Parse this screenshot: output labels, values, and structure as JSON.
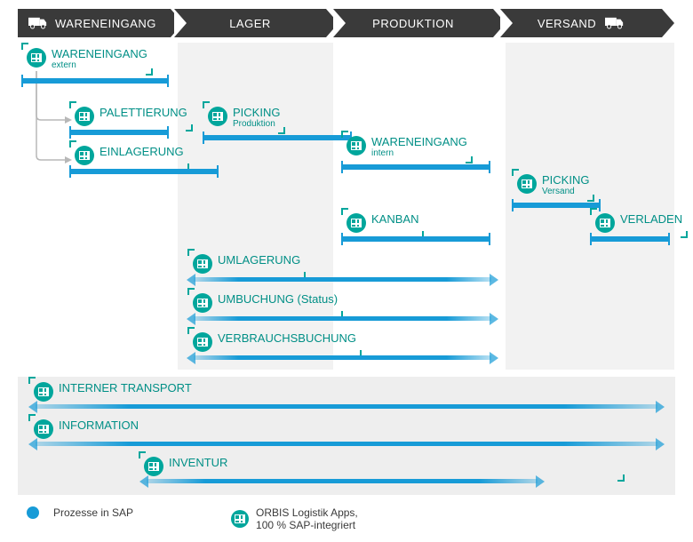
{
  "header": {
    "columns": [
      "WARENEINGANG",
      "LAGER",
      "PRODUKTION",
      "VERSAND"
    ]
  },
  "processes": {
    "wareneingang_extern": {
      "title": "WARENEINGANG",
      "sub": "extern"
    },
    "palettierung": {
      "title": "PALETTIERUNG"
    },
    "einlagerung": {
      "title": "EINLAGERUNG"
    },
    "picking_produktion": {
      "title": "PICKING",
      "sub": "Produktion"
    },
    "wareneingang_intern": {
      "title": "WARENEINGANG",
      "sub": "intern"
    },
    "kanban": {
      "title": "KANBAN"
    },
    "picking_versand": {
      "title": "PICKING",
      "sub": "Versand"
    },
    "verladen": {
      "title": "VERLADEN"
    },
    "umlagerung": {
      "title": "UMLAGERUNG"
    },
    "umbuchung": {
      "title": "UMBUCHUNG (Status)"
    },
    "verbrauchsbuchung": {
      "title": "VERBRAUCHSBUCHUNG"
    },
    "interner_transport": {
      "title": "INTERNER TRANSPORT"
    },
    "information": {
      "title": "INFORMATION"
    },
    "inventur": {
      "title": "INVENTUR"
    }
  },
  "legend": {
    "sap": "Prozesse in SAP",
    "orbis": "ORBIS Logistik Apps,\n100 % SAP-integriert"
  },
  "colors": {
    "bar": "#179bd7",
    "accent": "#00a69c",
    "header": "#3a3a3a"
  }
}
